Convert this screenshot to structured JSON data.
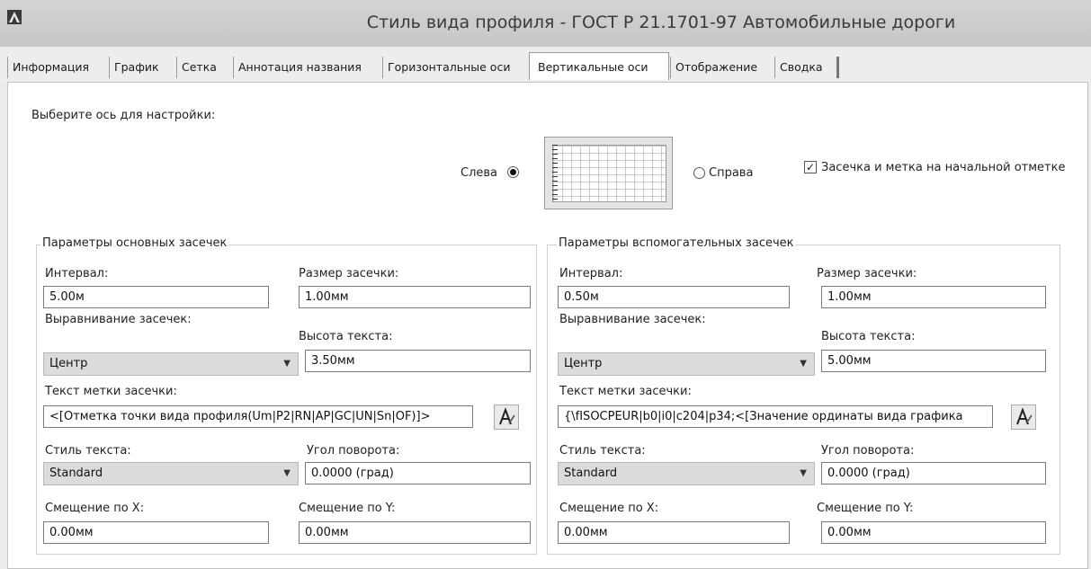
{
  "window": {
    "title": "Стиль вида профиля - ГОСТ Р 21.1701-97 Автомобильные дороги"
  },
  "tabs": [
    {
      "label": "Информация"
    },
    {
      "label": "График"
    },
    {
      "label": "Сетка"
    },
    {
      "label": "Аннотация названия"
    },
    {
      "label": "Горизонтальные оси"
    },
    {
      "label": "Вертикальные оси",
      "active": true
    },
    {
      "label": "Отображение"
    },
    {
      "label": "Сводка"
    }
  ],
  "axis_select": {
    "prompt": "Выберите ось для настройки:",
    "left_label": "Слева",
    "left_selected": true,
    "right_label": "Справа",
    "right_selected": false,
    "checkbox_label": "Засечка и метка на начальной отметке",
    "checkbox_checked": true,
    "check_glyph": "✓"
  },
  "major": {
    "title": "Параметры основных засечек",
    "interval_label": "Интервал:",
    "interval_value": "5.00м",
    "tick_size_label": "Размер засечки:",
    "tick_size_value": "1.00мм",
    "align_label": "Выравнивание засечек:",
    "align_value": "Центр",
    "text_height_label": "Высота текста:",
    "text_height_value": "3.50мм",
    "tick_text_label": "Текст метки засечки:",
    "tick_text_value": "<[Отметка точки вида профиля(Um|P2|RN|AP|GC|UN|Sn|OF)]>",
    "text_style_label": "Стиль текста:",
    "text_style_value": "Standard",
    "rotation_label": "Угол поворота:",
    "rotation_value": "0.0000 (град)",
    "offset_x_label": "Смещение по X:",
    "offset_x_value": "0.00мм",
    "offset_y_label": "Смещение по Y:",
    "offset_y_value": "0.00мм"
  },
  "minor": {
    "title": "Параметры вспомогательных засечек",
    "interval_label": "Интервал:",
    "interval_value": "0.50м",
    "tick_size_label": "Размер засечки:",
    "tick_size_value": "1.00мм",
    "align_label": "Выравнивание засечек:",
    "align_value": "Центр",
    "text_height_label": "Высота текста:",
    "text_height_value": "5.00мм",
    "tick_text_label": "Текст метки засечки:",
    "tick_text_value": "{\\fISOCPEUR|b0|i0|c204|p34;<[Значение ординаты вида графика",
    "text_style_label": "Стиль текста:",
    "text_style_value": "Standard",
    "rotation_label": "Угол поворота:",
    "rotation_value": "0.0000 (град)",
    "offset_x_label": "Смещение по X:",
    "offset_x_value": "0.00мм",
    "offset_y_label": "Смещение по Y:",
    "offset_y_value": "0.00мм"
  }
}
